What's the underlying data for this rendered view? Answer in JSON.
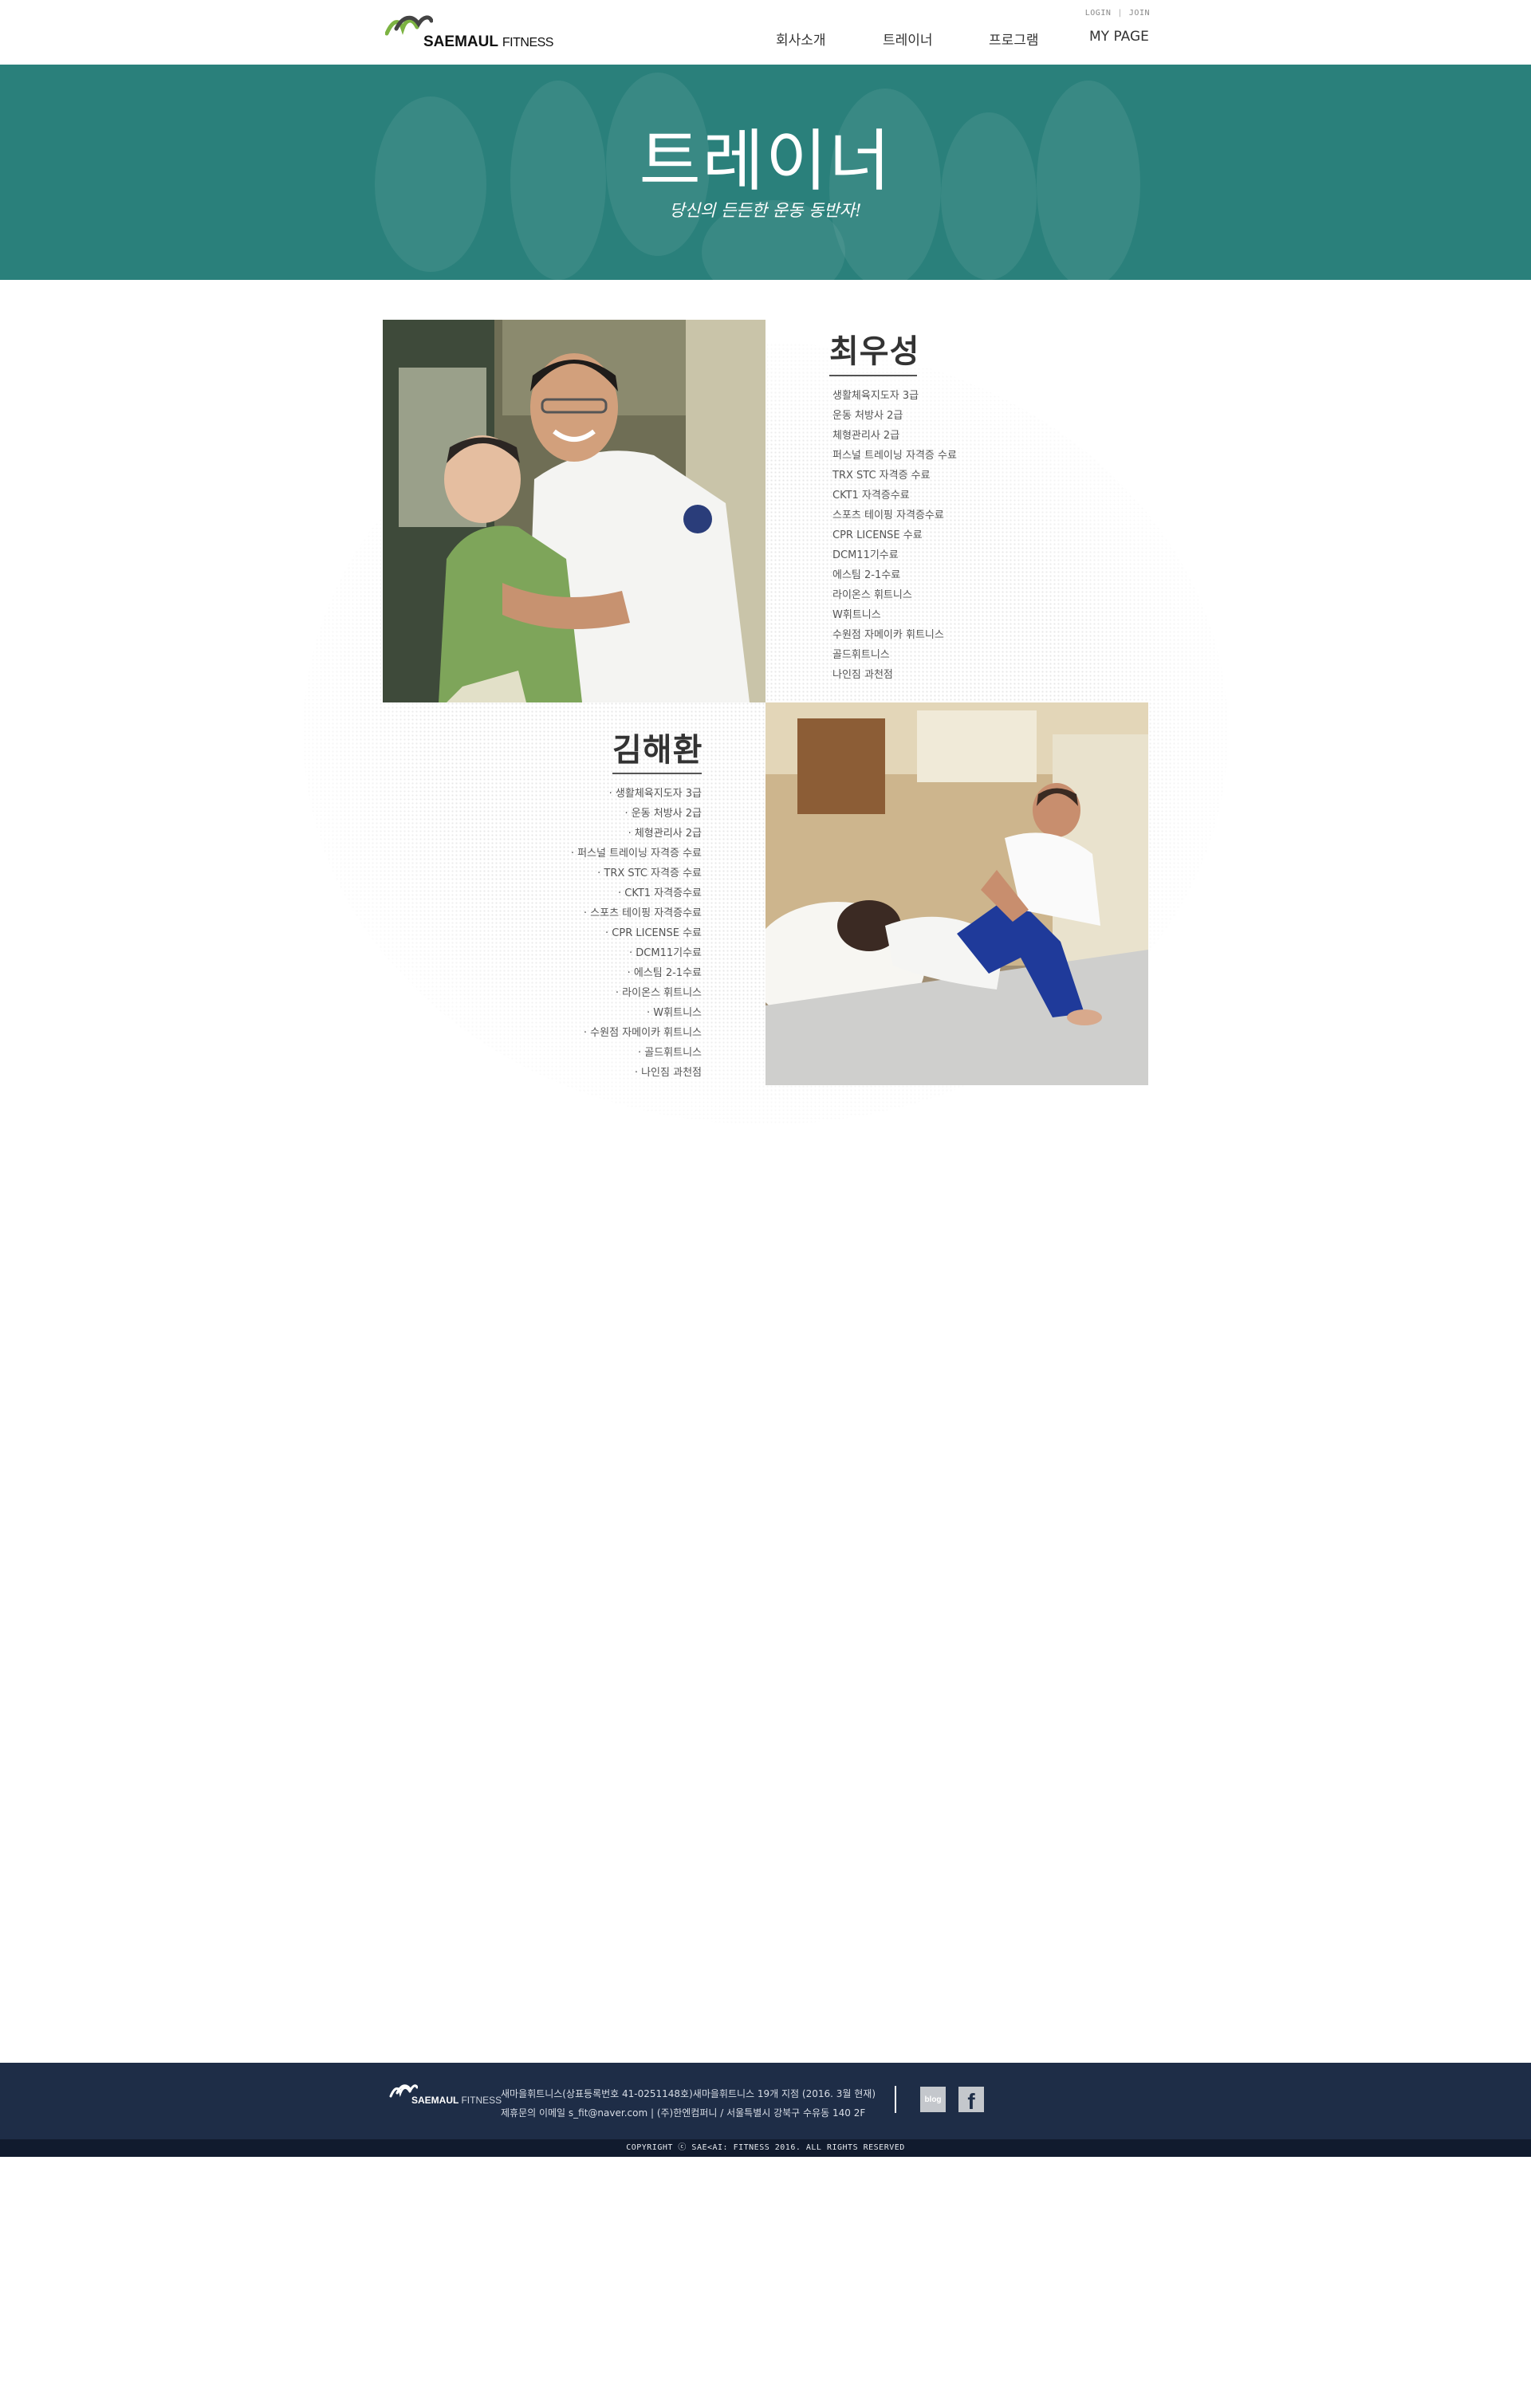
{
  "header": {
    "logo": {
      "brand": "SAEMAUL",
      "suffix": "FITNESS"
    },
    "util": {
      "login": "LOGIN",
      "separator": "|",
      "join": "JOIN"
    },
    "nav": [
      "회사소개",
      "트레이너",
      "프로그램",
      "MY PAGE"
    ]
  },
  "hero": {
    "title": "트레이너",
    "subtitle": "당신의 든든한 운동 동반자!"
  },
  "trainers": [
    {
      "name": "최우성",
      "certs": [
        "생활체육지도자 3급",
        "운동 처방사 2급",
        "체형관리사 2급",
        "퍼스널 트레이닝 자격증 수료",
        "TRX STC 자격증 수료",
        "CKT1 자격증수료",
        "스포츠 테이핑 자격증수료",
        "CPR LICENSE 수료",
        "DCM11기수료",
        "에스팀 2-1수료",
        "라이온스 휘트니스",
        "W휘트니스",
        "수원점 자메이카 휘트니스",
        "골드휘트니스",
        "나인짐 과천점"
      ]
    },
    {
      "name": "김해환",
      "certs": [
        "· 생활체육지도자 3급",
        "· 운동 처방사 2급",
        "· 체형관리사 2급",
        "· 퍼스널 트레이닝 자격증 수료",
        "· TRX STC 자격증 수료",
        "· CKT1 자격증수료",
        "· 스포츠 테이핑 자격증수료",
        "· CPR LICENSE 수료",
        "· DCM11기수료",
        "· 에스팀 2-1수료",
        "· 라이온스 휘트니스",
        "· W휘트니스",
        "· 수원점 자메이카 휘트니스",
        "· 골드휘트니스",
        "· 나인짐 과천점"
      ]
    }
  ],
  "footer": {
    "logo": {
      "brand": "SAEMAUL",
      "suffix": "FITNESS"
    },
    "info_line1": "새마을휘트니스(상표등록번호 41-0251148호)새마을휘트니스 19개 지점 (2016. 3월 현재)",
    "info_line2": "제휴문의 이메일 s_fit@naver.com  |  (주)한엔컴퍼니 / 서울특별시 강북구 수유동 140 2F",
    "sns": {
      "blog": "blog",
      "facebook": "f"
    },
    "copyright": "COPYRIGHT ⓒ SAE<AI: FITNESS 2016. ALL RIGHTS RESERVED"
  }
}
